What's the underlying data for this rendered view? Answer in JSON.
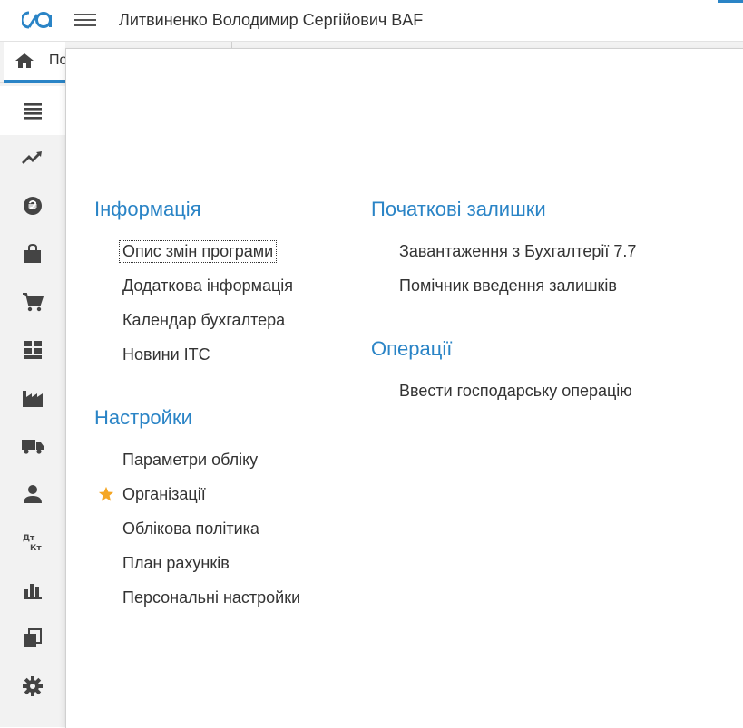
{
  "header": {
    "title": "Литвиненко Володимир Сергійович BAF"
  },
  "tabs": {
    "home_partial_label": "По"
  },
  "sidebar": {
    "items": [
      {
        "icon": "menu-list-icon"
      },
      {
        "icon": "trend-chart-icon"
      },
      {
        "icon": "currency-icon"
      },
      {
        "icon": "shopping-bag-icon"
      },
      {
        "icon": "cart-icon"
      },
      {
        "icon": "warehouse-icon"
      },
      {
        "icon": "factory-icon"
      },
      {
        "icon": "truck-icon"
      },
      {
        "icon": "person-icon"
      },
      {
        "icon": "debit-credit-icon"
      },
      {
        "icon": "bar-chart-icon"
      },
      {
        "icon": "documents-icon"
      },
      {
        "icon": "gear-icon"
      }
    ],
    "debit_credit_glyph": "Дт Кт"
  },
  "sections": {
    "info": {
      "title": "Інформація",
      "items": [
        "Опис змін програми",
        "Додаткова інформація",
        "Календар бухгалтера",
        "Новини ІТС"
      ]
    },
    "settings": {
      "title": "Настройки",
      "items": [
        "Параметри обліку",
        "Організації",
        "Облікова політика",
        "План рахунків",
        "Персональні настройки"
      ]
    },
    "initial_balances": {
      "title": "Початкові залишки",
      "items": [
        "Завантаження з Бухгалтерії 7.7",
        "Помічник введення залишків"
      ]
    },
    "operations": {
      "title": "Операції",
      "items": [
        "Ввести господарську операцію"
      ]
    }
  },
  "colors": {
    "accent": "#2a84c6",
    "favorite_star": "#f5a623"
  }
}
